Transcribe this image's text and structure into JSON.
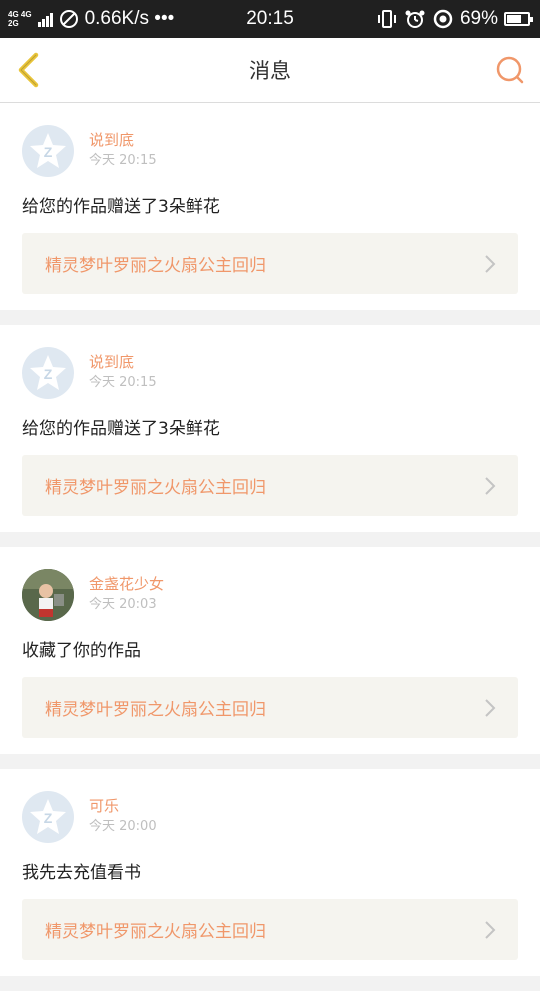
{
  "status": {
    "net_top": "4G 4G",
    "net_bottom": "2G",
    "speed": "0.66K/s •••",
    "time": "20:15",
    "battery": "69%",
    "battery_level": 0.69
  },
  "header": {
    "title": "消息"
  },
  "messages": [
    {
      "name": "说到底",
      "time": "今天 20:15",
      "text": "给您的作品赠送了3朵鲜花",
      "book": "精灵梦叶罗丽之火扇公主回归",
      "avatar": "default-qq-avatar-icon"
    },
    {
      "name": "说到底",
      "time": "今天 20:15",
      "text": "给您的作品赠送了3朵鲜花",
      "book": "精灵梦叶罗丽之火扇公主回归",
      "avatar": "default-qq-avatar-icon"
    },
    {
      "name": "金盏花少女",
      "time": "今天 20:03",
      "text": "收藏了你的作品",
      "book": "精灵梦叶罗丽之火扇公主回归",
      "avatar": "photo-avatar"
    },
    {
      "name": "可乐",
      "time": "今天 20:00",
      "text": "我先去充值看书",
      "book": "精灵梦叶罗丽之火扇公主回归",
      "avatar": "default-qq-avatar-icon"
    }
  ]
}
